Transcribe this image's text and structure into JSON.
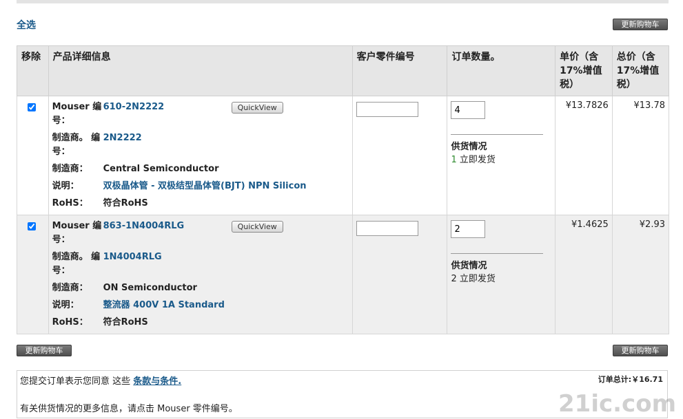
{
  "select_all": "全选",
  "update_cart": "更新购物车",
  "headers": {
    "remove": "移除",
    "product_info": "产品详细信息",
    "customer_part": "客户零件编号",
    "order_qty": "订单数量。",
    "unit_price": "单价（含17%增值税）",
    "total_price": "总价（含17%增值税）"
  },
  "labels": {
    "mouser_no": "Mouser 编号：",
    "mfr_no": "制造商。 编号：",
    "mfr": "制造商：",
    "desc": "说明：",
    "rohs": "RoHS：",
    "quickview": "QuickView",
    "supply": "供货情况"
  },
  "items": [
    {
      "checked": true,
      "mouser_no": "610-2N2222",
      "mfr_no": "2N2222",
      "mfr": "Central Semiconductor",
      "desc": "双极晶体管 - 双极结型晶体管(BJT) NPN Silicon",
      "rohs": "符合RoHS",
      "qty": "4",
      "supply_num": "1",
      "supply_text": " 立即发货",
      "unit_price": "¥13.7826",
      "total_price": "¥13.78"
    },
    {
      "checked": true,
      "mouser_no": "863-1N4004RLG",
      "mfr_no": "1N4004RLG",
      "mfr": "ON Semiconductor",
      "desc": "整流器 400V 1A Standard",
      "rohs": "符合RoHS",
      "qty": "2",
      "supply_num": "2",
      "supply_text": " 立即发货",
      "unit_price": "¥1.4625",
      "total_price": "¥2.93"
    }
  ],
  "footer": {
    "terms_prefix": "您提交订单表示您同意 这些 ",
    "terms_link": "条款与条件.",
    "total": "订单总计:￥16.71",
    "more_info": "有关供货情况的更多信息，请点击 Mouser 零件编号。"
  },
  "watermark": "21ic.com"
}
